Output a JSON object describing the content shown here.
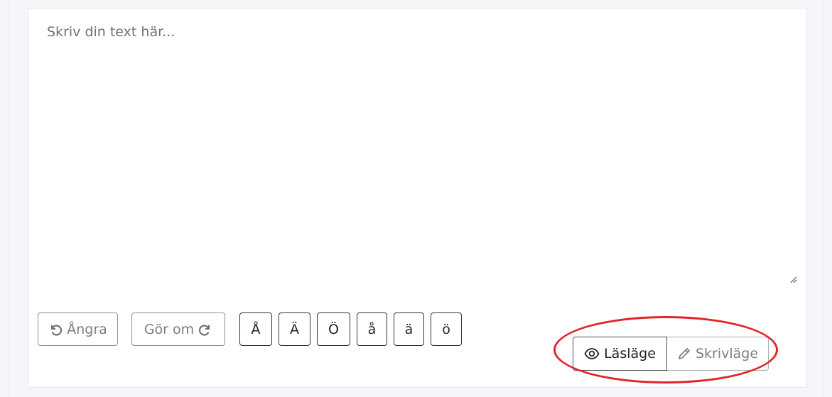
{
  "editor": {
    "placeholder": "Skriv din text här..."
  },
  "toolbar": {
    "undo_label": "Ångra",
    "redo_label": "Gör om",
    "chars": [
      "Å",
      "Ä",
      "Ö",
      "å",
      "ä",
      "ö"
    ]
  },
  "mode": {
    "read_label": "Läsläge",
    "write_label": "Skrivläge",
    "selected": "read"
  },
  "colors": {
    "highlight": "#e3232a",
    "text_muted": "#7a7e83",
    "text_dark": "#212529"
  }
}
